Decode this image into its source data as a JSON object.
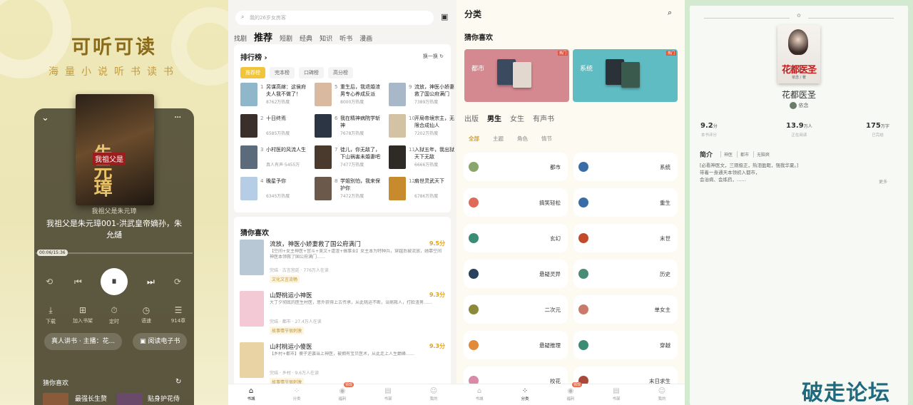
{
  "p1": {
    "title": "可听可读",
    "subtitle": "海量小说听书读书",
    "cover_title": "我祖父是",
    "cover_name": "朱元璋",
    "book_name": "我祖父是朱元璋",
    "chapter": "我祖父是朱元璋001-洪武皇帝嫡孙，朱允熥",
    "time": "00:06/15:36",
    "play_icon": "⏸",
    "tools": [
      {
        "icon": "⤓",
        "label": "下载"
      },
      {
        "icon": "⊞",
        "label": "加入书架"
      },
      {
        "icon": "⏱",
        "label": "定时"
      },
      {
        "icon": "◷",
        "label": "语速"
      },
      {
        "icon": "☰",
        "label": "914章"
      }
    ],
    "narrator": "真人讲书 · 主播：花...",
    "ebook": "阅读电子书",
    "guess": "猜你喜欢",
    "rec1": "最强长生赘",
    "rec2": "贴身护花侍"
  },
  "p2": {
    "search_placeholder": "我的26岁女房客",
    "tabs": [
      "找剧",
      "推荐",
      "短剧",
      "经典",
      "知识",
      "听书",
      "漫画"
    ],
    "ranking": "排行榜",
    "swap": "换一换",
    "chips": [
      "推荐榜",
      "完本榜",
      "口碑榜",
      "高分榜"
    ],
    "rank_items": [
      {
        "n": "1",
        "t": "另谋高嫁：这侯府夫人我不做了！",
        "h": "8762万热度",
        "c": "#8fb6c9"
      },
      {
        "n": "2",
        "t": "十日终焉",
        "h": "6585万热度",
        "c": "#3a2f2a"
      },
      {
        "n": "3",
        "t": "小村医的风流人生",
        "h": "真人有声·5455万",
        "c": "#5b6b7b"
      },
      {
        "n": "4",
        "t": "晚星予你",
        "h": "6345万热度",
        "c": "#b6cde6"
      },
      {
        "n": "5",
        "t": "重生后，我退婚渣男专心养成反派",
        "h": "8000万热度",
        "c": "#d9b9a0"
      },
      {
        "n": "6",
        "t": "我在精神病院学斩神",
        "h": "7678万热度",
        "c": "#2c3544"
      },
      {
        "n": "7",
        "t": "徒儿，你无敌了，下山祸害未婚妻吧",
        "h": "7477万热度",
        "c": "#4a3a2e"
      },
      {
        "n": "8",
        "t": "学姐别怕，我来保护你",
        "h": "7472万热度",
        "c": "#6b5a4c"
      },
      {
        "n": "9",
        "t": "流放，神医小娇妻救了国公府满门",
        "h": "7389万热度",
        "c": "#a8b8c8"
      },
      {
        "n": "10",
        "t": "开局帝境宗主，无限合成仙人",
        "h": "7202万热度",
        "c": "#d4c2a4"
      },
      {
        "n": "11",
        "t": "入狱五年，我出狱天下无敌",
        "h": "6666万热度",
        "c": "#2e2a26"
      },
      {
        "n": "12",
        "t": "肩世灵武天下",
        "h": "6786万热度",
        "c": "#c78a2c"
      }
    ],
    "guess": "猜你喜欢",
    "guess_items": [
      {
        "t": "流放，神医小娇妻救了国公府满门",
        "s": "9.5分",
        "d": "【空间+女主神医+宫斗+美文+虐渣+搞事业】女主本为特种兵，穿越后被流放，她靠空间神医本领救了国公府满门……",
        "m": "完结 · 古言宫廷 · 776万人在读",
        "tg": "文化文言流畅",
        "c": "#b8c8d4"
      },
      {
        "t": "山野桃运小神医",
        "s": "9.3分",
        "d": "大丁夕彻底的医生村医，意外获得上古传承，从此桃运不断，治病救人，打脸渣男……",
        "m": "完结 · 都市 · 27.4万人在读",
        "tg": "故事情节很刺激",
        "c": "#f2c9d4"
      },
      {
        "t": "山村桃运小傻医",
        "s": "9.3分",
        "d": "【乡村+都市】傻子逆袭当上神医，被拥有宝贝医术，从此走上人生巅峰……",
        "m": "完结 · 乡村 · 9.6万人在读",
        "tg": "故事情节很刺激",
        "c": "#e9d2a4"
      }
    ],
    "nav": [
      {
        "icon": "⌂",
        "label": "书城"
      },
      {
        "icon": "⁘",
        "label": "分类"
      },
      {
        "icon": "◉",
        "label": "福利",
        "badge": "领现"
      },
      {
        "icon": "▤",
        "label": "书架"
      },
      {
        "icon": "☺",
        "label": "我的"
      }
    ]
  },
  "p3": {
    "title": "分类",
    "guess": "猜你喜欢",
    "banners": [
      {
        "label": "都市",
        "hot": "热门",
        "bg": "#d4888f"
      },
      {
        "label": "系统",
        "hot": "热门",
        "bg": "#5fbcc2"
      }
    ],
    "tabs": [
      "出版",
      "男生",
      "女生",
      "有声书"
    ],
    "subtabs": [
      "全部",
      "主题",
      "角色",
      "情节"
    ],
    "cats": [
      {
        "l": "都市",
        "c": "#8aa66d"
      },
      {
        "l": "系统",
        "c": "#3a6da8"
      },
      {
        "l": "搞笑轻松",
        "c": "#e06a5a"
      },
      {
        "l": "重生",
        "c": "#3a6da8"
      },
      {
        "l": "玄幻",
        "c": "#3b8c74"
      },
      {
        "l": "末世",
        "c": "#c24a2a"
      },
      {
        "l": "悬疑灵异",
        "c": "#29415c"
      },
      {
        "l": "历史",
        "c": "#4a8a78"
      },
      {
        "l": "二次元",
        "c": "#8a8a3a"
      },
      {
        "l": "单女主",
        "c": "#c97a6a"
      },
      {
        "l": "悬疑推理",
        "c": "#e08a3a"
      },
      {
        "l": "穿越",
        "c": "#3b8c74"
      },
      {
        "l": "校花",
        "c": "#d98aa8"
      },
      {
        "l": "末日求生",
        "c": "#a84a3a"
      }
    ],
    "nav": [
      {
        "icon": "⌂",
        "label": "书城"
      },
      {
        "icon": "⁘",
        "label": "分类"
      },
      {
        "icon": "◉",
        "label": "福利",
        "badge": "领现"
      },
      {
        "icon": "▤",
        "label": "书架"
      },
      {
        "icon": "☺",
        "label": "我的"
      }
    ]
  },
  "p4": {
    "cover_title": "花都医圣",
    "cover_author": "依念 / 著",
    "book_name": "花都医圣",
    "author": "依念",
    "stats": [
      {
        "v": "9.2",
        "u": "分",
        "l": "本书评分"
      },
      {
        "v": "13.9",
        "u": "万人",
        "l": "正在阅读"
      },
      {
        "v": "175",
        "u": "万字",
        "l": "已完结"
      }
    ],
    "intro": "简介",
    "tags": [
      "神医",
      "都市",
      "无脑爽"
    ],
    "desc": [
      "[必看神医文，三观极正，热泪盈眶，强我华夏。]",
      "带着一身通天本领初入都市，",
      "会治病、会炼药，……"
    ],
    "more": "更多",
    "watermark": "破走论坛"
  }
}
